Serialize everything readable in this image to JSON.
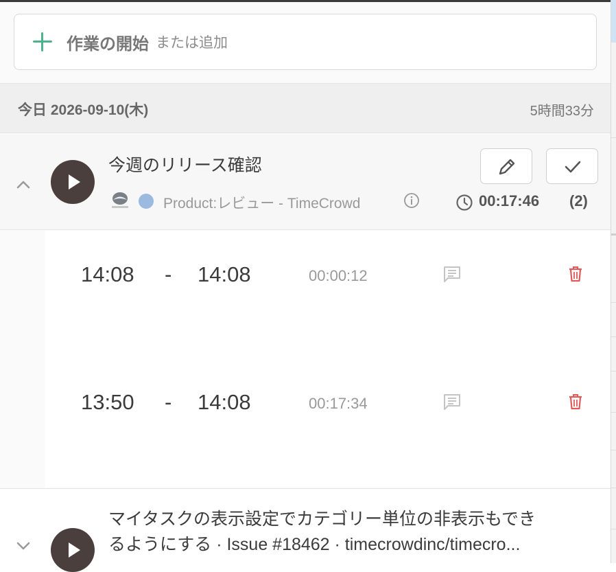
{
  "start": {
    "main_label": "作業の開始",
    "sub_label": "または追加"
  },
  "day": {
    "label": "今日 2026-09-10(木)",
    "total": "5時間33分"
  },
  "entry": {
    "title": "今週のリリース確認",
    "category": "Product:レビュー - TimeCrowd",
    "duration": "00:17:46",
    "count": "(2)",
    "category_color": "#9cb9e0"
  },
  "sub_entries": [
    {
      "start": "14:08",
      "dash": "-",
      "end": "14:08",
      "duration": "00:00:12"
    },
    {
      "start": "13:50",
      "dash": "-",
      "end": "14:08",
      "duration": "00:17:34"
    }
  ],
  "entry2": {
    "title_line1": "マイタスクの表示設定でカテゴリー単位の非表示もでき",
    "title_line2": "るようにする · Issue #18462 · timecrowdinc/timecro..."
  },
  "icons": [
    "plus-icon",
    "chevron-up-icon",
    "play-icon",
    "timecrowd-logo-icon",
    "info-icon",
    "pencil-icon",
    "check-icon",
    "clock-icon",
    "comment-icon",
    "trash-icon",
    "chevron-down-icon"
  ],
  "colors": {
    "accent": "#4cb48c",
    "delete": "#e05a5a",
    "play": "#4a3f3d"
  }
}
